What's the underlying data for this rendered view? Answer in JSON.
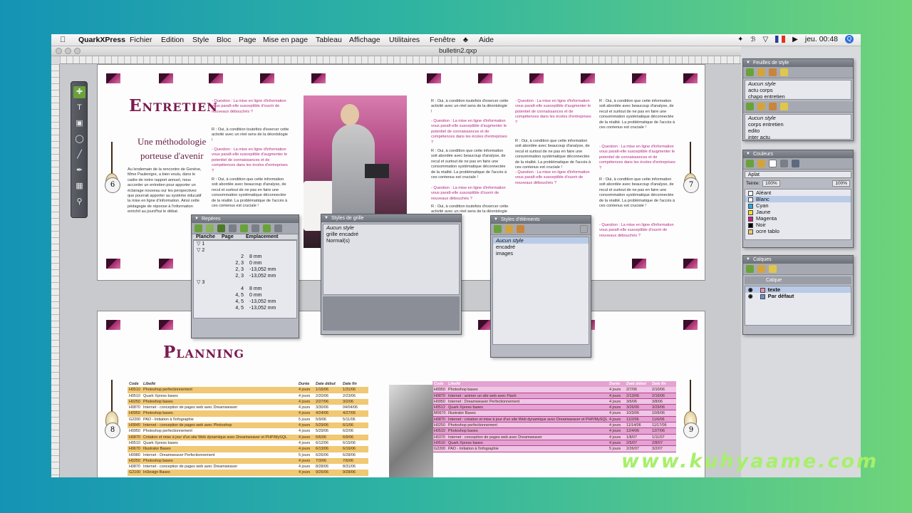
{
  "menubar": {
    "app_name": "QuarkXPress",
    "items": [
      "Fichier",
      "Edition",
      "Style",
      "Bloc",
      "Page",
      "Mise en page",
      "Tableau",
      "Affichage",
      "Utilitaires",
      "Fenêtre",
      "Aide"
    ],
    "clock": "jeu. 00:48",
    "spotlight": "Q"
  },
  "window": {
    "title": "bulletin2.qxp"
  },
  "spread_top": {
    "left_heading": "Entretien",
    "subtitle_line1": "Une méthodologie",
    "subtitle_line2": "porteuse d'avenir",
    "intro_text": "Au lendemain de la rencontre de Genève, Mme Paulenigre, a bien voulu, dans le cadre de notre rapport annuel, nous accorder un entretien pour apporter un éclairage nouveau sur les perspectives que pourrait apporter au système éducatif la mise en ligne d'information. Ainsi cette pédagogie de réponse à l'information enrichit au jourd'hui le débat.",
    "q1": "- Question : La mise en ligne d'information vous paraît-elle susceptible d'ouvrir de nouveaux débouchés ?",
    "r1": "R : Oui, à condition toutefois d'exercer cette activité avec un réel sens de la déontologie !",
    "q2": "- Question : La mise en ligne d'information vous paraît-elle susceptible d'augmenter le potentiel de connaissances et de compétences dans les écoles d'entreprises ?",
    "r2": "R : Oui, à condition que cette information soit abordée avec beaucoup d'analyse, de recul et surtout de ne pas en faire une consommation systématique déconnectée de la réalité. La problématique de l'accès à ces contenus est cruciale !",
    "page_left_number": "6",
    "page_right_number": "7"
  },
  "spread_bottom": {
    "heading": "Planning",
    "page_left_number": "8",
    "page_right_number": "9",
    "table_headers": [
      "Code",
      "Libellé",
      "Durée",
      "Date début",
      "Date fin"
    ],
    "yellow_rows": [
      [
        "H0510",
        "Photoshop perfectionnement",
        "4 jours",
        "1/16/06",
        "1/31/06"
      ],
      [
        "H0510",
        "Quark Xpress bases",
        "4 jours",
        "2/20/06",
        "2/23/06"
      ],
      [
        "H0250",
        "Photoshop bases",
        "4 jours",
        "2/27/06",
        "3/2/06"
      ],
      [
        "H0870",
        "Internet - conception de pages web avec Dreamweaver",
        "4 jours",
        "3/30/06",
        "04/04/06"
      ],
      [
        "H0950",
        "Photoshop bases",
        "4 jours",
        "4/24/06",
        "4/27/06"
      ],
      [
        "G2200",
        "PAO - Initiation à l'infographie",
        "5 jours",
        "5/9/06",
        "5/11/06"
      ],
      [
        "H0840",
        "Internet - conception de pages web avec Photoshop",
        "4 jours",
        "5/29/06",
        "6/1/06"
      ],
      [
        "H0950",
        "Photoshop perfectionnement",
        "4 jours",
        "5/29/06",
        "6/2/06"
      ],
      [
        "H0870",
        "Création et mise à jour d'un site Web dynamique avec Dreamweaver et PHP/MySQL",
        "4 jours",
        "6/6/06",
        "6/9/06"
      ],
      [
        "H0510",
        "Quark Xpress bases",
        "4 jours",
        "6/12/06",
        "6/15/06"
      ],
      [
        "H0670",
        "Illustrator Bases",
        "4 jours",
        "6/13/06",
        "6/16/06"
      ],
      [
        "H0980",
        "Internet - Dreamweaver Perfectionnement",
        "5 jours",
        "6/26/06",
        "6/28/06"
      ],
      [
        "H0250",
        "Photoshop bases",
        "4 jours",
        "7/3/06",
        "7/6/06"
      ],
      [
        "H0870",
        "Internet - conception de pages web avec Dreamweaver",
        "4 jours",
        "8/28/06",
        "8/31/06"
      ],
      [
        "G2100",
        "InDesign Bases",
        "4 jours",
        "9/25/06",
        "9/28/06"
      ]
    ],
    "pink_rows": [
      [
        "H0950",
        "Photoshop bases",
        "4 jours",
        "2/7/06",
        "2/10/06"
      ],
      [
        "H0870",
        "Internet : animer un site web avec Flash",
        "4 jours",
        "2/13/06",
        "2/16/06"
      ],
      [
        "H0950",
        "Internet : Dreamweaver Perfectionnement",
        "4 jours",
        "3/6/06",
        "3/8/06"
      ],
      [
        "H0512",
        "Quark Xpress bases",
        "4 jours",
        "3/26/06",
        "3/29/06"
      ],
      [
        "M0670",
        "Illustrator Bases",
        "4 jours",
        "10/3/06",
        "10/6/06"
      ],
      [
        "H0870",
        "Internet : création et mise à jour d'un site Web dynamique avec Dreamweaver et PHP/MySQL",
        "4 jours",
        "11/2/06",
        "11/6/06"
      ],
      [
        "H0250",
        "Photoshop perfectionnement",
        "4 jours",
        "11/14/06",
        "11/17/06"
      ],
      [
        "H0510",
        "Photoshop bases",
        "4 jours",
        "12/4/06",
        "12/7/06"
      ],
      [
        "H0370",
        "Internet : conception de pages web avec Dreamweaver",
        "4 jours",
        "1/8/07",
        "1/11/07"
      ],
      [
        "H0510",
        "Quark Xpress bases",
        "4 jours",
        "2/5/07",
        "2/8/07"
      ],
      [
        "G2200",
        "PAO - Initiation à l'infographie",
        "5 jours",
        "2/26/07",
        "3/2/07"
      ]
    ]
  },
  "palette_reperes": {
    "title": "Repères",
    "headers": [
      "Planche",
      "Page",
      "Emplacement"
    ],
    "rows": [
      [
        "1",
        "",
        ""
      ],
      [
        "2",
        "",
        ""
      ],
      [
        "",
        "2",
        "8 mm"
      ],
      [
        "",
        "2, 3",
        "0 mm"
      ],
      [
        "",
        "2, 3",
        "-13,052 mm"
      ],
      [
        "",
        "2, 3",
        "-13,052 mm"
      ],
      [
        "3",
        "",
        ""
      ],
      [
        "",
        "4",
        "8 mm"
      ],
      [
        "",
        "4, 5",
        "0 mm"
      ],
      [
        "",
        "4, 5",
        "-13,052 mm"
      ],
      [
        "",
        "4, 5",
        "-13,052 mm"
      ]
    ]
  },
  "palette_grille": {
    "title": "Styles de grille",
    "items": [
      "Aucun style",
      "grille encadré",
      "Normal(s)"
    ]
  },
  "palette_elements": {
    "title": "Styles d'éléments",
    "items": [
      "Aucun style",
      "encadré",
      "images"
    ]
  },
  "palette_feuilles": {
    "title": "Feuilles de style",
    "para_items": [
      "Aucun style",
      "actu corps",
      "chapo entretien"
    ],
    "char_items": [
      "Aucun style",
      "corps entretien",
      "edito",
      "inter actu"
    ]
  },
  "palette_couleurs": {
    "title": "Couleurs",
    "fill_mode": "Aplat",
    "tint_label": "Teinte:",
    "tint_value": "100%",
    "opacity_value": "100%",
    "items": [
      {
        "name": "Aléant",
        "color": "#ffffff"
      },
      {
        "name": "Blanc",
        "color": "#ffffff"
      },
      {
        "name": "Cyan",
        "color": "#2aa9e0"
      },
      {
        "name": "Jaune",
        "color": "#f2e01d"
      },
      {
        "name": "Magenta",
        "color": "#d5168a"
      },
      {
        "name": "Noir",
        "color": "#000000"
      },
      {
        "name": "ocre tablo",
        "color": "#f1c873"
      }
    ]
  },
  "palette_calques": {
    "title": "Calques",
    "header": "Calque",
    "items": [
      {
        "name": "texte",
        "color": "#e88fb8"
      },
      {
        "name": "Par défaut",
        "color": "#6d8fd0"
      }
    ]
  },
  "watermark": "www.kuhyaame.com"
}
